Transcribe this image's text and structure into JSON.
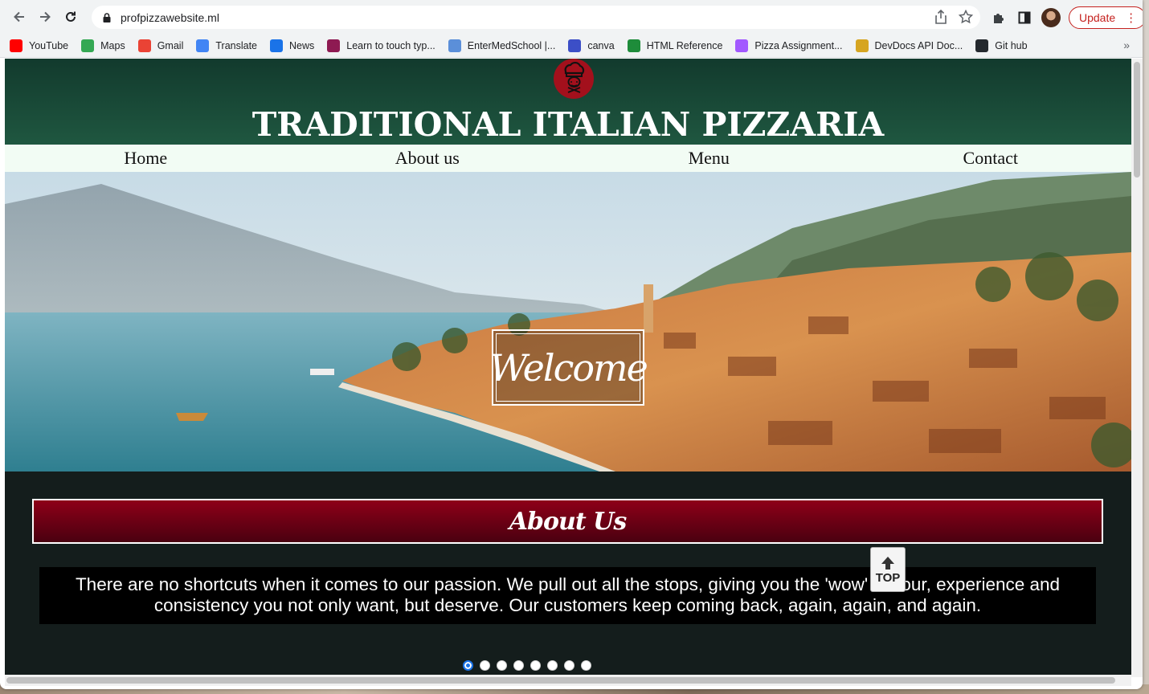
{
  "browser": {
    "url": "profpizzawebsite.ml",
    "update_label": "Update"
  },
  "bookmarks": [
    {
      "label": "YouTube",
      "color": "#ff0000"
    },
    {
      "label": "Maps",
      "color": "#34a853"
    },
    {
      "label": "Gmail",
      "color": "#ea4335"
    },
    {
      "label": "Translate",
      "color": "#4285f4"
    },
    {
      "label": "News",
      "color": "#1a73e8"
    },
    {
      "label": "Learn to touch typ...",
      "color": "#8e1a52"
    },
    {
      "label": "EnterMedSchool |...",
      "color": "#5b8fd9"
    },
    {
      "label": "canva",
      "color": "#3c4fc7"
    },
    {
      "label": "HTML Reference",
      "color": "#1e8c3a"
    },
    {
      "label": "Pizza Assignment...",
      "color": "#a259ff"
    },
    {
      "label": "DevDocs API Doc...",
      "color": "#d6a521"
    },
    {
      "label": "Git hub",
      "color": "#24292e"
    }
  ],
  "site": {
    "title": "TRADITIONAL ITALIAN PIZZARIA",
    "nav": [
      "Home",
      "About us",
      "Menu",
      "Contact"
    ],
    "hero_caption": "Welcome",
    "about_heading": "About Us",
    "about_text": "There are no shortcuts when it comes to our passion. We pull out all the stops, giving you the 'wow' flavour, experience and consistency you not only want, but deserve. Our customers keep coming back, again, again, and again.",
    "slider_dots": 8,
    "slider_active": 1,
    "top_button_label": "TOP"
  },
  "colors": {
    "header_green": "#1f5740",
    "nav_bg": "#f2fcf4",
    "about_red": "#8e0018",
    "page_bg": "#141d1c"
  }
}
